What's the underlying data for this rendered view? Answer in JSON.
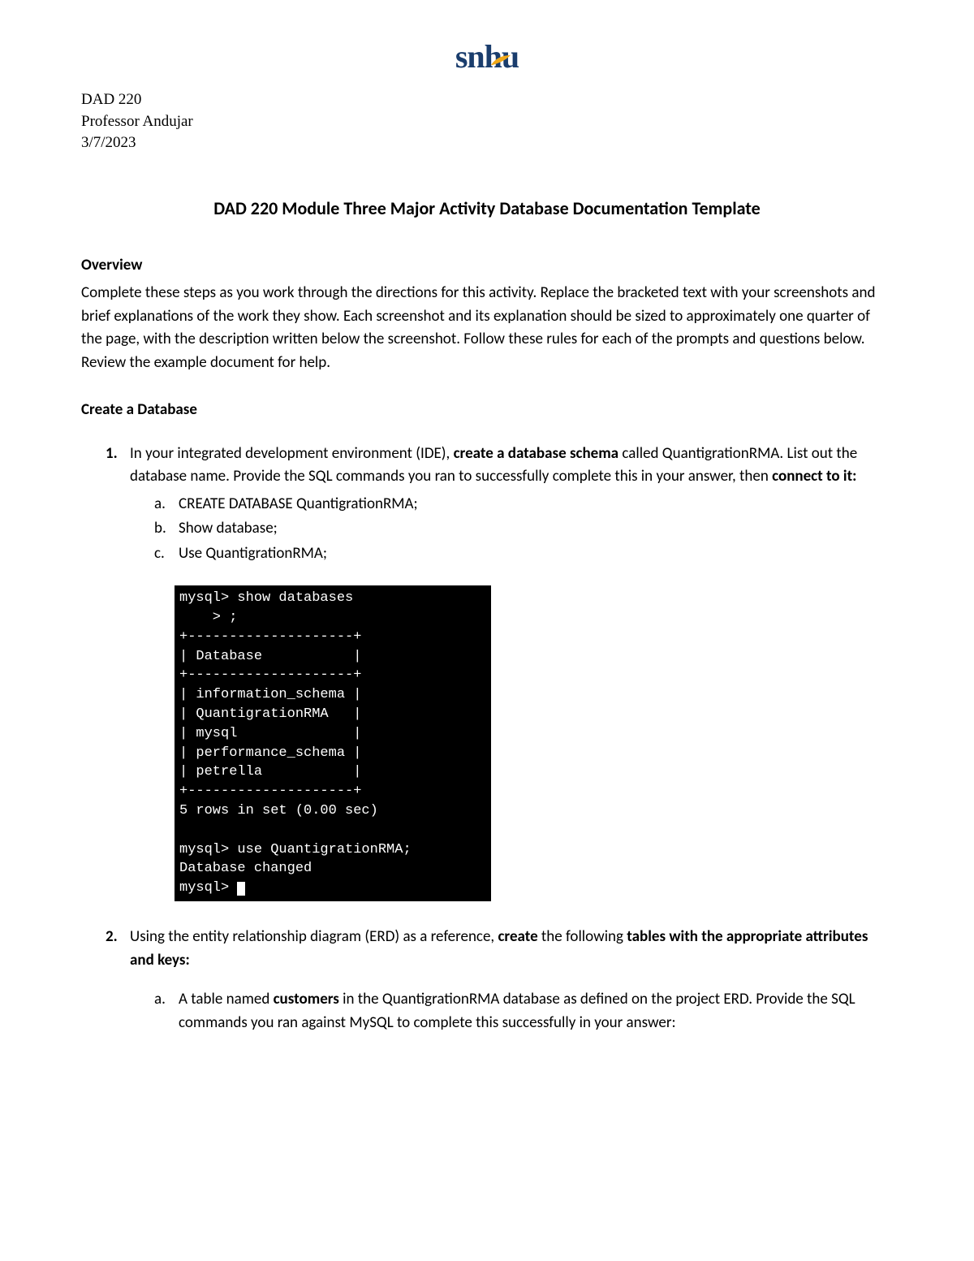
{
  "logo": {
    "text": "snhu"
  },
  "header": {
    "course": "DAD 220",
    "professor": "Professor Andujar",
    "date": "3/7/2023"
  },
  "title": "DAD 220 Module Three Major Activity Database Documentation Template",
  "overview": {
    "heading": "Overview",
    "text": "Complete these steps as you work through the directions for this activity. Replace the bracketed text with your screenshots and brief explanations of the work they show. Each screenshot and its explanation should be sized to approximately one quarter of the page, with the description written below the screenshot. Follow these rules for each of the prompts and questions below. Review the example document for help."
  },
  "createdb": {
    "heading": "Create a Database",
    "item1": {
      "num": "1.",
      "prefix": "In your integrated development environment (IDE), ",
      "bold1": "create a database schema",
      "mid": " called QuantigrationRMA. List out the database name. Provide the SQL commands you ran to successfully complete this in your answer, then ",
      "bold2": "connect to it:",
      "sub_a_letter": "a.",
      "sub_a_text": "CREATE DATABASE QuantigrationRMA;",
      "sub_b_letter": "b.",
      "sub_b_text": "Show database;",
      "sub_c_letter": "c.",
      "sub_c_text": "Use QuantigrationRMA;"
    },
    "terminal": {
      "line1": "mysql> show databases",
      "line2": "    > ;",
      "line3": "+--------------------+",
      "line4": "| Database           |",
      "line5": "+--------------------+",
      "line6": "| information_schema |",
      "line7": "| QuantigrationRMA   |",
      "line8": "| mysql              |",
      "line9": "| performance_schema |",
      "line10": "| petrella           |",
      "line11": "+--------------------+",
      "line12": "5 rows in set (0.00 sec)",
      "line13": "",
      "line14": "mysql> use QuantigrationRMA;",
      "line15": "Database changed",
      "line16": "mysql> "
    },
    "item2": {
      "num": "2.",
      "prefix": "Using the entity relationship diagram (ERD) as a reference, ",
      "bold1": "create",
      "mid": " the following ",
      "bold2": "tables with the appropriate attributes and keys:",
      "sub_a_letter": "a.",
      "sub_a_prefix": "A table named ",
      "sub_a_bold": "customers",
      "sub_a_suffix": " in the QuantigrationRMA database as defined on the project ERD. Provide the SQL commands you ran against MySQL to complete this successfully in your answer:"
    }
  }
}
